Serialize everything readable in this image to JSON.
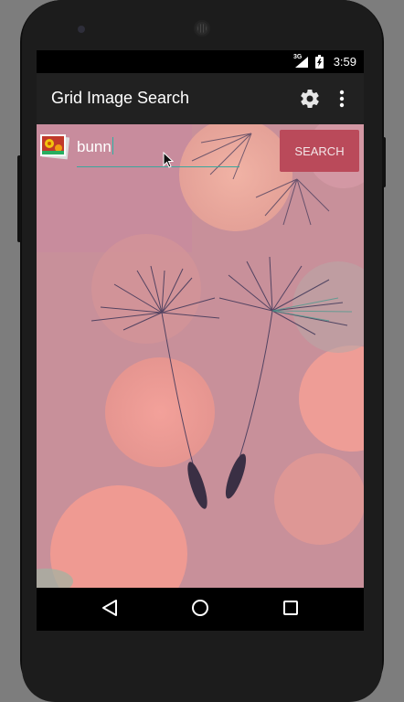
{
  "status_bar": {
    "network": "3G",
    "time": "3:59"
  },
  "action_bar": {
    "title": "Grid Image Search",
    "settings_icon": "gear-icon",
    "overflow_icon": "more-vert-icon"
  },
  "search": {
    "query": "bunn",
    "button_label": "SEARCH"
  },
  "nav_bar": {
    "back_icon": "back-triangle-icon",
    "home_icon": "home-circle-icon",
    "recents_icon": "recents-square-icon"
  },
  "colors": {
    "accent": "#2bb2a4",
    "search_button": "#ba4a5a",
    "action_bar": "#212121",
    "background": "#c98f96"
  }
}
